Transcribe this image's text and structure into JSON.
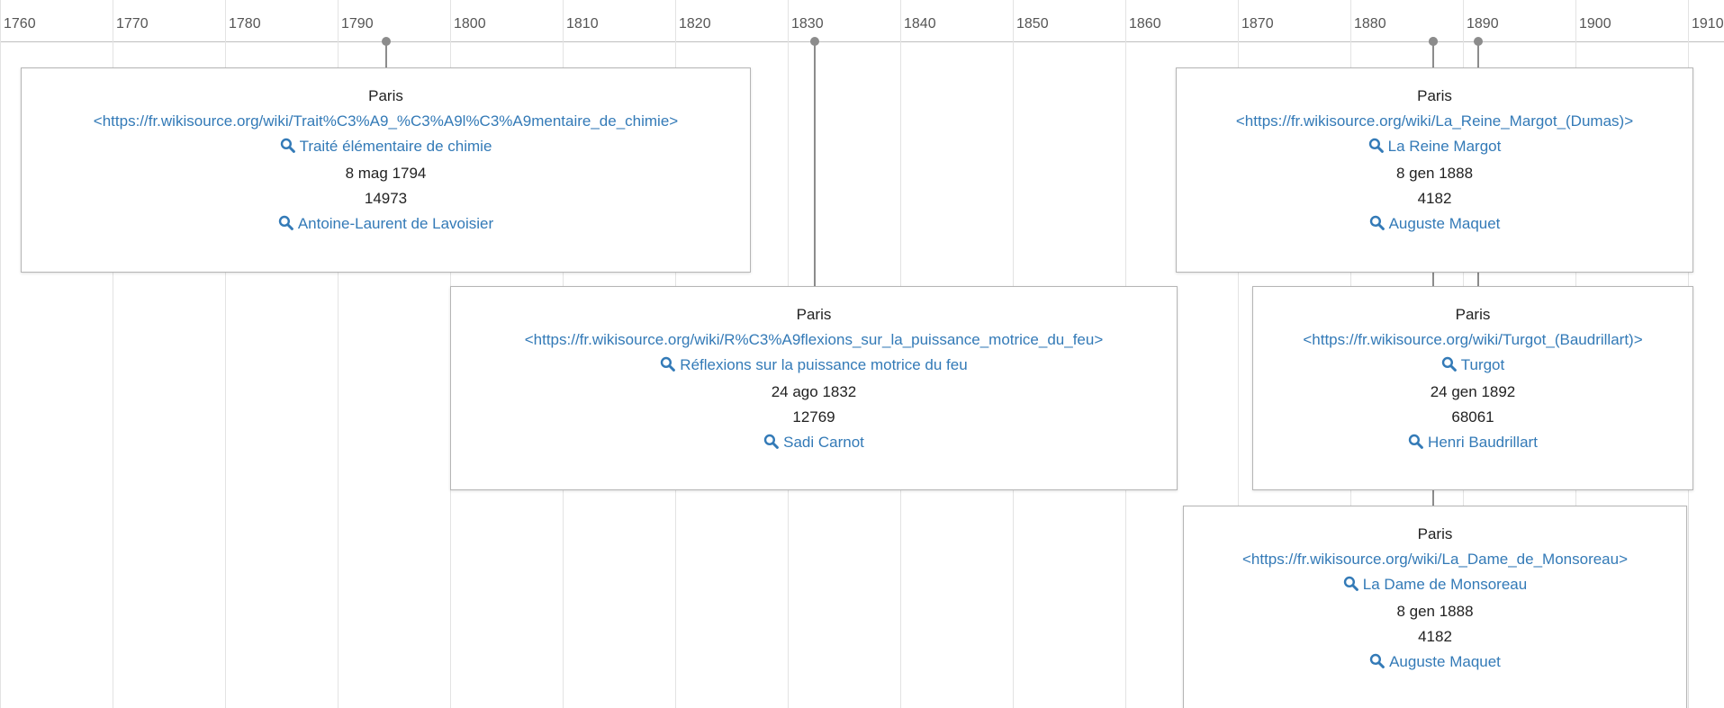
{
  "timeline": {
    "ticks": [
      "1760",
      "1770",
      "1780",
      "1790",
      "1800",
      "1810",
      "1820",
      "1830",
      "1840",
      "1850",
      "1860",
      "1870",
      "1880",
      "1890",
      "1900",
      "1910"
    ],
    "events": [
      {
        "place": "Paris",
        "url": "<https://fr.wikisource.org/wiki/Trait%C3%A9_%C3%A9l%C3%A9mentaire_de_chimie>",
        "title": "Traité élémentaire de chimie",
        "date": "8 mag 1794",
        "count": "14973",
        "author": "Antoine-Laurent de Lavoisier"
      },
      {
        "place": "Paris",
        "url": "<https://fr.wikisource.org/wiki/R%C3%A9flexions_sur_la_puissance_motrice_du_feu>",
        "title": "Réflexions sur la puissance motrice du feu",
        "date": "24 ago 1832",
        "count": "12769",
        "author": "Sadi Carnot"
      },
      {
        "place": "Paris",
        "url": "<https://fr.wikisource.org/wiki/La_Reine_Margot_(Dumas)>",
        "title": "La Reine Margot",
        "date": "8 gen 1888",
        "count": "4182",
        "author": "Auguste Maquet"
      },
      {
        "place": "Paris",
        "url": "<https://fr.wikisource.org/wiki/Turgot_(Baudrillart)>",
        "title": "Turgot",
        "date": "24 gen 1892",
        "count": "68061",
        "author": "Henri Baudrillart"
      },
      {
        "place": "Paris",
        "url": "<https://fr.wikisource.org/wiki/La_Dame_de_Monsoreau>",
        "title": "La Dame de Monsoreau",
        "date": "8 gen 1888",
        "count": "4182",
        "author": "Auguste Maquet"
      }
    ]
  },
  "colors": {
    "link": "#337ab7",
    "marker": "#8c8c8c",
    "gridline": "#e3e3e3",
    "card_border": "#b5b5b5"
  },
  "icons": {
    "title_icon": "search-icon",
    "author_icon": "search-icon"
  }
}
